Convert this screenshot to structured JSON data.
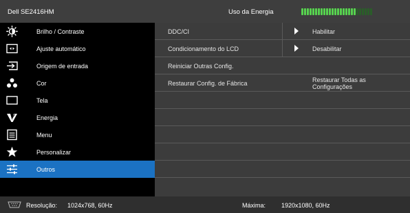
{
  "header": {
    "model": "Dell SE2416HM",
    "energy_label": "Uso da Energia",
    "energy_level": 0.78,
    "meter_on_color": "#57d34f",
    "meter_off_color": "#2a5e29"
  },
  "menu": {
    "selected_color": "#1b72c3",
    "items": [
      {
        "label": "Brilho / Contraste",
        "icon": "brightness-icon"
      },
      {
        "label": "Ajuste automático",
        "icon": "auto-adjust-icon"
      },
      {
        "label": "Origem de entrada",
        "icon": "input-source-icon"
      },
      {
        "label": "Cor",
        "icon": "color-icon"
      },
      {
        "label": "Tela",
        "icon": "display-icon"
      },
      {
        "label": "Energia",
        "icon": "energy-icon"
      },
      {
        "label": "Menu",
        "icon": "menu-icon"
      },
      {
        "label": "Personalizar",
        "icon": "star-icon"
      },
      {
        "label": "Outros",
        "icon": "others-icon",
        "selected": true
      }
    ]
  },
  "others": {
    "rows": [
      {
        "label": "DDC/CI",
        "value": "Habilitar"
      },
      {
        "label": "Condicionamento do LCD",
        "value": "Desabilitar"
      },
      {
        "label": "Reiniciar Outras Config.",
        "value": ""
      },
      {
        "label": "Restaurar Config. de Fábrica",
        "value": "Restaurar Todas as Configurações"
      }
    ]
  },
  "footer": {
    "connector_icon": "vga-connector-icon",
    "resolution_label": "Resolução:",
    "resolution_value": "1024x768, 60Hz",
    "max_label": "Máxima:",
    "max_value": "1920x1080, 60Hz"
  }
}
